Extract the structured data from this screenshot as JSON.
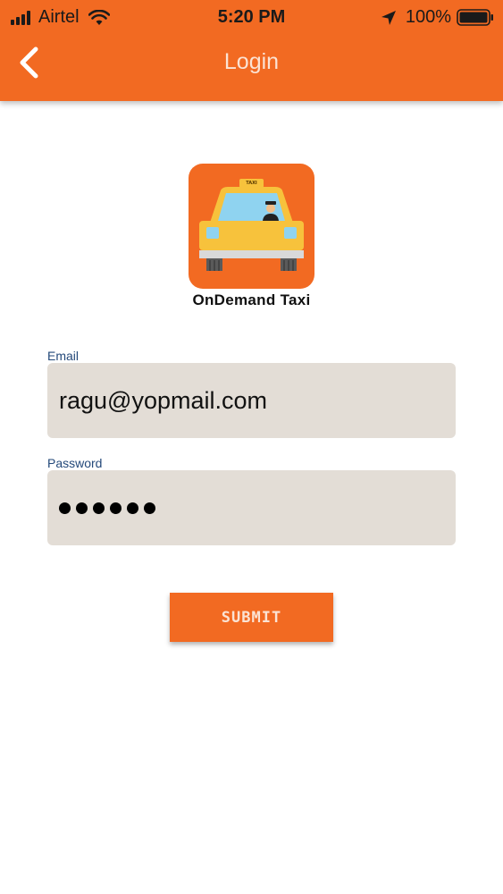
{
  "status_bar": {
    "carrier": "Airtel",
    "time": "5:20 PM",
    "battery": "100%"
  },
  "nav": {
    "title": "Login",
    "back_icon": "chevron-left-icon"
  },
  "app": {
    "name": "OnDemand Taxi",
    "logo_sign": "TAXI"
  },
  "form": {
    "email_label": "Email",
    "email_value": "ragu@yopmail.com",
    "password_label": "Password",
    "password_length": 6,
    "submit_label": "SUBMIT"
  },
  "colors": {
    "accent": "#f26a22",
    "field_bg": "#e3ddd6",
    "label": "#24497a"
  }
}
